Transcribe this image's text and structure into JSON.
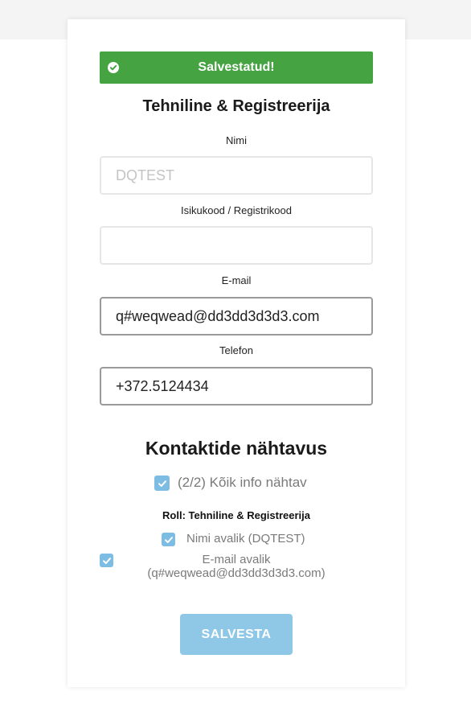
{
  "alert": {
    "text": "Salvestatud!",
    "icon": "check-circle-icon",
    "color": "#45a342"
  },
  "form": {
    "title": "Tehniline & Registreerija",
    "name_label": "Nimi",
    "name_placeholder": "DQTEST",
    "name_value": "",
    "idcode_label": "Isikukood / Registrikood",
    "idcode_value": "",
    "email_label": "E-mail",
    "email_value": "q#weqwead@dd3dd3d3d3.com",
    "phone_label": "Telefon",
    "phone_value": "+372.5124434"
  },
  "visibility": {
    "title": "Kontaktide nähtavus",
    "all_visible_label": "(2/2) Kõik info nähtav",
    "all_visible_checked": true,
    "role_label": "Roll: Tehniline & Registreerija",
    "name_public_label": "Nimi avalik (DQTEST)",
    "name_public_checked": true,
    "email_public_line1": "E-mail avalik",
    "email_public_line2": "(q#weqwead@dd3dd3d3d3.com)",
    "email_public_checked": true
  },
  "save_button": {
    "label": "SALVESTA",
    "color": "#8ec8e6"
  },
  "colors": {
    "checkbox": "#7dbde3",
    "topbar": "#f4f4f4"
  }
}
